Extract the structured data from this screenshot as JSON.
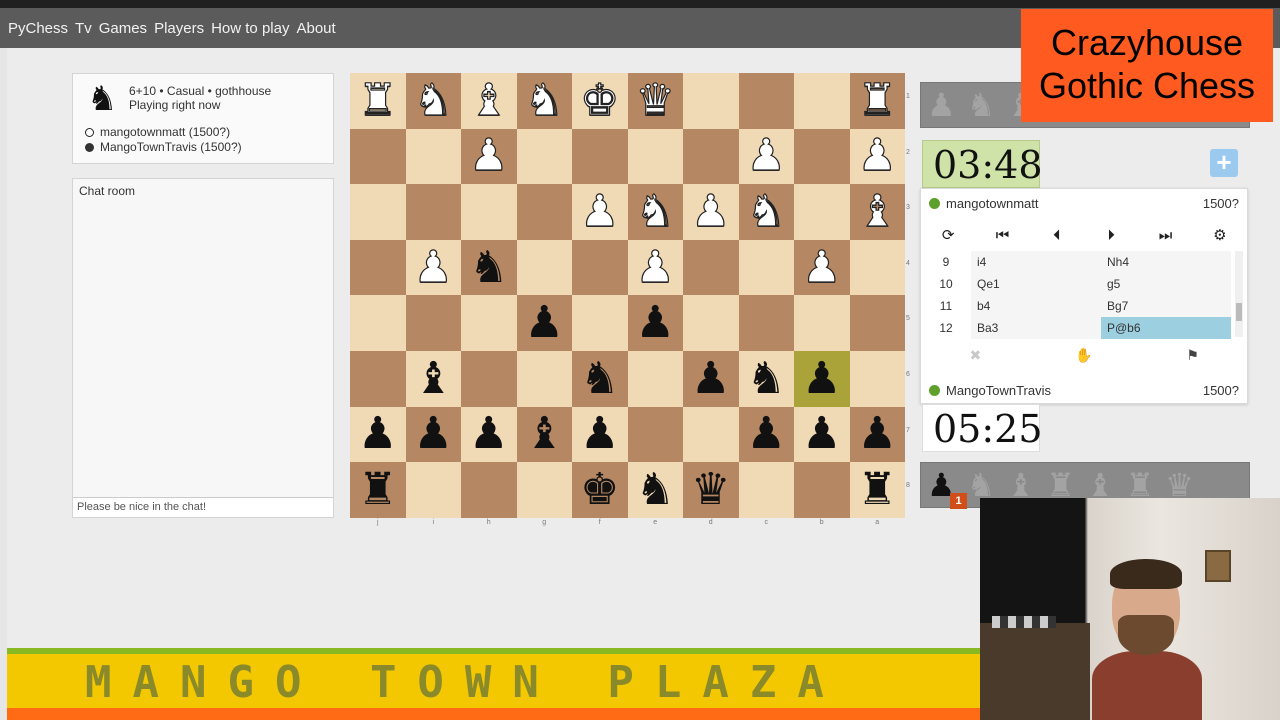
{
  "nav": {
    "items": [
      "PyChess",
      "Tv",
      "Games",
      "Players",
      "How to play",
      "About"
    ]
  },
  "game_info": {
    "knight_glyph": "♞",
    "line1": "6+10 • Casual • gothhouse",
    "line2": "Playing right now",
    "white_player": "mangotownmatt (1500?)",
    "black_player": "MangoTownTravis (1500?)"
  },
  "chat": {
    "title": "Chat room",
    "placeholder": "Please be nice in the chat!"
  },
  "board": {
    "files": [
      "j",
      "i",
      "h",
      "g",
      "f",
      "e",
      "d",
      "c",
      "b",
      "a"
    ],
    "ranks": [
      "1",
      "2",
      "3",
      "4",
      "5",
      "6",
      "7",
      "8"
    ],
    "rows": [
      [
        "wR",
        "wN",
        "wB",
        "wN",
        "wK",
        "wQ",
        "",
        "",
        "",
        "wR"
      ],
      [
        "",
        "",
        "wP",
        "",
        "",
        "",
        "",
        "wP",
        "",
        "wP"
      ],
      [
        "",
        "",
        "",
        "",
        "wP",
        "wN",
        "wP",
        "wN",
        "",
        "wB"
      ],
      [
        "",
        "wP",
        "bN",
        "",
        "",
        "wP",
        "",
        "",
        "wP",
        ""
      ],
      [
        "",
        "",
        "",
        "bP",
        "",
        "bP",
        "",
        "",
        "",
        ""
      ],
      [
        "",
        "bB",
        "",
        "",
        "bN",
        "",
        "bP",
        "bN",
        "bP",
        ""
      ],
      [
        "bP",
        "bP",
        "bP",
        "bB",
        "bP",
        "",
        "",
        "bP",
        "bP",
        "bP"
      ],
      [
        "bR",
        "",
        "",
        "",
        "bK",
        "bN",
        "bQ",
        "",
        "",
        "bR"
      ]
    ],
    "highlight": [
      5,
      8
    ]
  },
  "pieces": {
    "K": "♚",
    "Q": "♛",
    "R": "♜",
    "B": "♝",
    "N": "♞",
    "P": "♟"
  },
  "pocket_top": {
    "slots": [
      "♟",
      "♞",
      "♝",
      "♜",
      "♛"
    ]
  },
  "pocket_bottom": {
    "slots": [
      "♟",
      "♞",
      "♝",
      "♜",
      "♝",
      "♜",
      "♛"
    ],
    "count": "1"
  },
  "clocks": {
    "top": "03:48",
    "bottom": "05:25"
  },
  "players": {
    "top_name": "mangotownmatt",
    "top_rating": "1500?",
    "bottom_name": "MangoTownTravis",
    "bottom_rating": "1500?"
  },
  "controls": {
    "flip": "⟳",
    "first": "⏮",
    "prev": "⏴",
    "next": "⏵",
    "last": "⏭",
    "settings": "⚙"
  },
  "moves": [
    {
      "num": "9",
      "white": "i4",
      "black": "Nh4"
    },
    {
      "num": "10",
      "white": "Qe1",
      "black": "g5"
    },
    {
      "num": "11",
      "white": "b4",
      "black": "Bg7"
    },
    {
      "num": "12",
      "white": "Ba3",
      "black": "P@b6"
    }
  ],
  "actions": {
    "abort": "✖",
    "draw": "✋",
    "resign": "⚑"
  },
  "plus_label": "+",
  "overlay": {
    "line1": "Crazyhouse",
    "line2": "Gothic Chess"
  },
  "banner": {
    "text": "MANGO TOWN PLAZA"
  },
  "colors": {
    "light_square": "#f0d9b5",
    "dark_square": "#b58863",
    "highlight": "#a9a33a",
    "overlay_bg": "#ff5a1f",
    "banner_bg": "#f4c800"
  }
}
